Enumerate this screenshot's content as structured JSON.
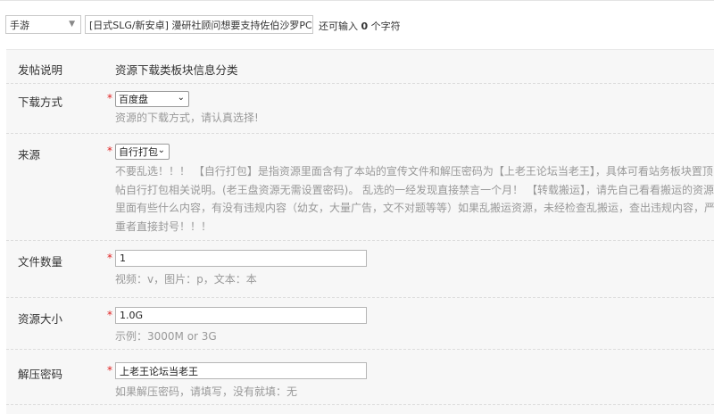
{
  "header": {
    "category_value": "手游",
    "title_value": "[日式SLG/新安卓] 漫研社顾问想要支持佐伯沙罗PC+安卓",
    "remain_prefix": "还可输入",
    "remain_count": "0",
    "remain_suffix": "个字符"
  },
  "form": {
    "post_info": {
      "label": "发帖说明",
      "value": "资源下载类板块信息分类"
    },
    "download": {
      "label": "下载方式",
      "star": "*",
      "select": "百度盘",
      "hint": "资源的下载方式，请认真选择!"
    },
    "source": {
      "label": "来源",
      "star": "*",
      "select": "自行打包",
      "hint": "不要乱选！！！ 【自行打包】是指资源里面含有了本站的宣传文件和解压密码为【上老王论坛当老王】，具体可看站务板块置顶帖自行打包相关说明。(老王盘资源无需设置密码)。 乱选的一经发现直接禁言一个月！ 【转载搬运】，请先自己看看搬运的资源里面有些什么内容，有没有违规内容（幼女，大量广告，文不对题等等）如果乱搬运资源，未经检查乱搬运，查出违规内容，严重者直接封号！！！"
    },
    "file_count": {
      "label": "文件数量",
      "star": "*",
      "value": "1",
      "hint": "视频：v，图片：p，文本：本"
    },
    "size": {
      "label": "资源大小",
      "star": "*",
      "value": "1.0G",
      "hint": "示例：3000M or 3G"
    },
    "password": {
      "label": "解压密码",
      "star": "*",
      "value": "上老王论坛当老王",
      "hint": "如果解压密码，请填写，没有就填：无"
    }
  },
  "icons": {
    "dropdown": "chevron-down-icon"
  }
}
